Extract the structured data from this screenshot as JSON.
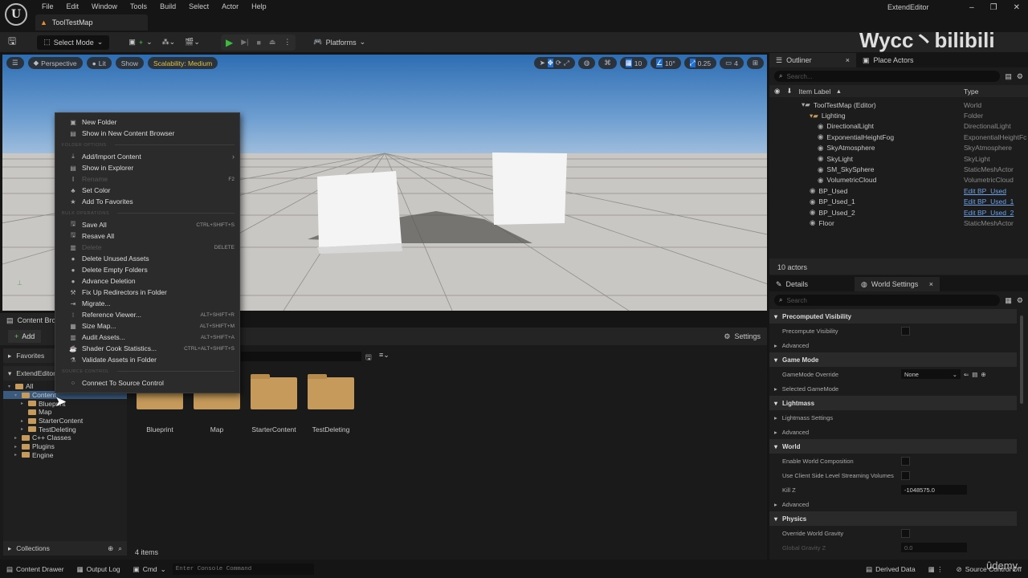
{
  "menubar": {
    "items": [
      "File",
      "Edit",
      "Window",
      "Tools",
      "Build",
      "Select",
      "Actor",
      "Help"
    ],
    "map_tab": "ToolTestMap",
    "project": "ExtendEditor"
  },
  "toolbar": {
    "select_mode": "Select Mode",
    "platforms": "Platforms"
  },
  "viewport": {
    "perspective": "Perspective",
    "lit": "Lit",
    "show": "Show",
    "scalability": "Scalability: Medium",
    "grid_snap": "10",
    "rot_snap": "10°",
    "scale_snap": "0.25",
    "cam_speed": "4"
  },
  "watermark": {
    "text": "Wycc丶bilibili",
    "udemy": "ûdemy"
  },
  "context_menu": {
    "items_top": [
      {
        "label": "New Folder",
        "icon": "folder-plus"
      },
      {
        "label": "Show in New Content Browser",
        "icon": "browser"
      }
    ],
    "section_folder": "FOLDER OPTIONS",
    "items_folder": [
      {
        "label": "Add/Import Content",
        "icon": "import",
        "submenu": true
      },
      {
        "label": "Show in Explorer",
        "icon": "explorer"
      },
      {
        "label": "Rename",
        "shortcut": "F2",
        "disabled": true,
        "icon": "rename"
      },
      {
        "label": "Set Color",
        "icon": "palette"
      },
      {
        "label": "Add To Favorites",
        "icon": "star"
      }
    ],
    "section_bulk": "BULK OPERATIONS",
    "items_bulk": [
      {
        "label": "Save All",
        "shortcut": "CTRL+SHIFT+S",
        "icon": "save"
      },
      {
        "label": "Resave All",
        "icon": "save"
      },
      {
        "label": "Delete",
        "shortcut": "DELETE",
        "disabled": true,
        "icon": "delete"
      },
      {
        "label": "Delete Unused Assets",
        "icon": "delete-unused"
      },
      {
        "label": "Delete Empty Folders",
        "icon": "delete-folders"
      },
      {
        "label": "Advance Deletion",
        "icon": "advance-delete"
      },
      {
        "label": "Fix Up Redirectors in Folder",
        "icon": "wrench"
      },
      {
        "label": "Migrate...",
        "icon": "migrate"
      },
      {
        "label": "Reference Viewer...",
        "shortcut": "ALT+SHIFT+R",
        "icon": "reference"
      },
      {
        "label": "Size Map...",
        "shortcut": "ALT+SHIFT+M",
        "icon": "size-map"
      },
      {
        "label": "Audit Assets...",
        "shortcut": "ALT+SHIFT+A",
        "icon": "audit"
      },
      {
        "label": "Shader Cook Statistics...",
        "shortcut": "CTRL+ALT+SHIFT+S",
        "icon": "shader"
      },
      {
        "label": "Validate Assets in Folder",
        "icon": "flask"
      }
    ],
    "section_source": "SOURCE CONTROL",
    "items_source": [
      {
        "label": "Connect To Source Control",
        "icon": "source-control"
      }
    ]
  },
  "outliner": {
    "tab": "Outliner",
    "tab2": "Place Actors",
    "search_placeholder": "Search...",
    "col_label": "Item Label",
    "col_type": "Type",
    "rows": [
      {
        "label": "ToolTestMap (Editor)",
        "type": "World",
        "indent": 0
      },
      {
        "label": "Lighting",
        "type": "Folder",
        "indent": 1
      },
      {
        "label": "DirectionalLight",
        "type": "DirectionalLight",
        "indent": 2
      },
      {
        "label": "ExponentialHeightFog",
        "type": "ExponentialHeightFc",
        "indent": 2
      },
      {
        "label": "SkyAtmosphere",
        "type": "SkyAtmosphere",
        "indent": 2
      },
      {
        "label": "SkyLight",
        "type": "SkyLight",
        "indent": 2
      },
      {
        "label": "SM_SkySphere",
        "type": "StaticMeshActor",
        "indent": 2
      },
      {
        "label": "VolumetricCloud",
        "type": "VolumetricCloud",
        "indent": 2
      },
      {
        "label": "BP_Used",
        "type": "Edit BP_Used",
        "link": true,
        "indent": 1
      },
      {
        "label": "BP_Used_1",
        "type": "Edit BP_Used_1",
        "link": true,
        "indent": 1
      },
      {
        "label": "BP_Used_2",
        "type": "Edit BP_Used_2",
        "link": true,
        "indent": 1
      },
      {
        "label": "Floor",
        "type": "StaticMeshActor",
        "indent": 1
      }
    ],
    "count": "10 actors"
  },
  "details": {
    "tab": "Details",
    "tab2": "World Settings",
    "search_placeholder": "Search",
    "sections": [
      {
        "title": "Precomputed Visibility",
        "props": [
          {
            "label": "Precompute Visibility",
            "kind": "check"
          },
          {
            "label": "Advanced",
            "kind": "expander"
          }
        ]
      },
      {
        "title": "Game Mode",
        "props": [
          {
            "label": "GameMode Override",
            "kind": "select",
            "value": "None"
          },
          {
            "label": "Selected GameMode",
            "kind": "expander"
          }
        ]
      },
      {
        "title": "Lightmass",
        "props": [
          {
            "label": "Lightmass Settings",
            "kind": "expander"
          },
          {
            "label": "Advanced",
            "kind": "expander"
          }
        ]
      },
      {
        "title": "World",
        "props": [
          {
            "label": "Enable World Composition",
            "kind": "check"
          },
          {
            "label": "Use Client Side Level Streaming Volumes",
            "kind": "check"
          },
          {
            "label": "Kill Z",
            "kind": "field",
            "value": "-1048575.0"
          },
          {
            "label": "Advanced",
            "kind": "expander"
          }
        ]
      },
      {
        "title": "Physics",
        "props": [
          {
            "label": "Override World Gravity",
            "kind": "check"
          },
          {
            "label": "Global Gravity Z",
            "kind": "field",
            "value": "0.0",
            "disabled": true
          }
        ]
      }
    ]
  },
  "content_browser": {
    "tab": "Content Browser",
    "add": "Add",
    "settings": "Settings",
    "favorites": "Favorites",
    "project": "ExtendEditor",
    "collections": "Collections",
    "item_count": "4 items",
    "tree": [
      {
        "label": "All",
        "indent": 0
      },
      {
        "label": "Content",
        "indent": 1,
        "selected": true
      },
      {
        "label": "Blueprint",
        "indent": 2
      },
      {
        "label": "Map",
        "indent": 2
      },
      {
        "label": "StarterContent",
        "indent": 2
      },
      {
        "label": "TestDeleting",
        "indent": 2
      },
      {
        "label": "C++ Classes",
        "indent": 1
      },
      {
        "label": "Plugins",
        "indent": 1
      },
      {
        "label": "Engine",
        "indent": 1
      }
    ],
    "folders": [
      "Blueprint",
      "Map",
      "StarterContent",
      "TestDeleting"
    ]
  },
  "statusbar": {
    "content_drawer": "Content Drawer",
    "output_log": "Output Log",
    "cmd": "Cmd",
    "console_placeholder": "Enter Console Command",
    "derived_data": "Derived Data",
    "source_control": "Source Control Off"
  }
}
